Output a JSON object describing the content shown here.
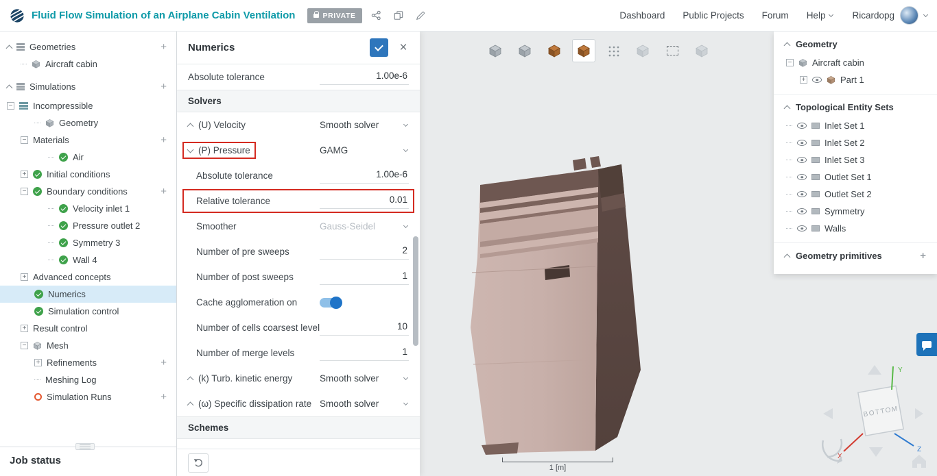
{
  "colors": {
    "accent_blue": "#2e76bc",
    "title_teal": "#0e9aa8",
    "selected_row": "#d7ebf8",
    "annotation_red": "#d42a20",
    "toggle_blue": "#1f74c8",
    "check_green": "#3fa24b",
    "runs_red": "#e4572e"
  },
  "header": {
    "project_title": "Fluid Flow Simulation of an Airplane Cabin Ventilation",
    "privacy_badge": "PRIVATE",
    "nav_items": [
      {
        "label": "Dashboard"
      },
      {
        "label": "Public Projects"
      },
      {
        "label": "Forum"
      },
      {
        "label": "Help",
        "has_caret": true
      }
    ],
    "username": "Ricardopg"
  },
  "left_tree": {
    "items": [
      {
        "label": "Geometries",
        "level": 0,
        "expander": "caret",
        "icon": "layers-icon",
        "plus": true
      },
      {
        "label": "Aircraft cabin",
        "level": 1,
        "icon": "geometry-icon",
        "dash": true
      },
      {
        "label": "Simulations",
        "level": 0,
        "expander": "caret",
        "icon": "simulations-icon",
        "plus": true
      },
      {
        "label": "Incompressible",
        "level": 0,
        "expander": "minus",
        "icon": "flow-icon"
      },
      {
        "label": "Geometry",
        "level": 2,
        "icon": "geometry-icon",
        "dash": true
      },
      {
        "label": "Materials",
        "level": 1,
        "expander": "minus",
        "plus": true
      },
      {
        "label": "Air",
        "level": 3,
        "icon": "check-icon",
        "dash": true
      },
      {
        "label": "Initial conditions",
        "level": 1,
        "expander": "plus",
        "icon": "check-icon"
      },
      {
        "label": "Boundary conditions",
        "level": 1,
        "expander": "minus",
        "icon": "check-icon",
        "plus": true
      },
      {
        "label": "Velocity inlet 1",
        "level": 3,
        "icon": "check-icon",
        "dash": true
      },
      {
        "label": "Pressure outlet 2",
        "level": 3,
        "icon": "check-icon",
        "dash": true
      },
      {
        "label": "Symmetry 3",
        "level": 3,
        "icon": "check-icon",
        "dash": true
      },
      {
        "label": "Wall 4",
        "level": 3,
        "icon": "check-icon",
        "dash": true
      },
      {
        "label": "Advanced concepts",
        "level": 1,
        "expander": "plus"
      },
      {
        "label": "Numerics",
        "level": 2,
        "icon": "check-icon",
        "selected": true
      },
      {
        "label": "Simulation control",
        "level": 2,
        "icon": "check-icon"
      },
      {
        "label": "Result control",
        "level": 1,
        "expander": "plus"
      },
      {
        "label": "Mesh",
        "level": 1,
        "expander": "minus",
        "icon": "mesh-icon"
      },
      {
        "label": "Refinements",
        "level": 2,
        "expander": "plus",
        "plus": true
      },
      {
        "label": "Meshing Log",
        "level": 2,
        "dash": true
      },
      {
        "label": "Simulation Runs",
        "level": 2,
        "icon": "runs-icon",
        "plus": true
      }
    ]
  },
  "job_status": {
    "label": "Job status"
  },
  "numerics_panel": {
    "title": "Numerics",
    "rows": [
      {
        "type": "input",
        "label": "Absolute tolerance",
        "value": "1.00e-6"
      },
      {
        "type": "section",
        "label": "Solvers"
      },
      {
        "type": "select",
        "label": "(U) Velocity",
        "value": "Smooth solver",
        "collapser": "up"
      },
      {
        "type": "select",
        "label": "(P) Pressure",
        "value": "GAMG",
        "collapser": "down",
        "highlight": "label"
      },
      {
        "type": "input",
        "label": "Absolute tolerance",
        "value": "1.00e-6",
        "indent": true
      },
      {
        "type": "input",
        "label": "Relative tolerance",
        "value": "0.01",
        "indent": true,
        "highlight": "row"
      },
      {
        "type": "select",
        "label": "Smoother",
        "value": "Gauss-Seidel",
        "indent": true,
        "disabled": true
      },
      {
        "type": "input",
        "label": "Number of pre sweeps",
        "value": "2",
        "indent": true
      },
      {
        "type": "input",
        "label": "Number of post sweeps",
        "value": "1",
        "indent": true
      },
      {
        "type": "toggle",
        "label": "Cache agglomeration on",
        "on": true,
        "indent": true
      },
      {
        "type": "input",
        "label": "Number of cells coarsest level",
        "value": "10",
        "indent": true
      },
      {
        "type": "input",
        "label": "Number of merge levels",
        "value": "1",
        "indent": true
      },
      {
        "type": "select",
        "label": "(k) Turb. kinetic energy",
        "value": "Smooth solver",
        "collapser": "up"
      },
      {
        "type": "select",
        "label": "(ω) Specific dissipation rate",
        "value": "Smooth solver",
        "collapser": "up"
      },
      {
        "type": "section",
        "label": "Schemes"
      }
    ]
  },
  "viewport": {
    "toolbar": [
      {
        "name": "view-geometry-icon"
      },
      {
        "name": "view-solid-icon"
      },
      {
        "name": "view-surfaces-icon",
        "accent": true
      },
      {
        "name": "view-volumes-icon",
        "accent": true,
        "selected": true
      },
      {
        "name": "view-grid-icon"
      },
      {
        "name": "view-transparent-icon",
        "disabled": true
      },
      {
        "name": "box-select-icon"
      },
      {
        "name": "view-mesh-icon",
        "disabled": true
      }
    ],
    "scale_label": "1 [m]",
    "nav_cube_label": "BOTTOM",
    "axes": {
      "x": "X",
      "y": "Y",
      "z": "Z"
    }
  },
  "right_panel": {
    "sections": [
      {
        "title": "Geometry",
        "items": [
          {
            "label": "Aircraft cabin",
            "expander": "minus",
            "icon": "part-gray-icon",
            "level": 0
          },
          {
            "label": "Part 1",
            "expander": "plus",
            "eye": true,
            "icon": "part-tan-icon",
            "level": 1
          }
        ]
      },
      {
        "title": "Topological Entity Sets",
        "items": [
          {
            "label": "Inlet Set 1",
            "dash": true,
            "eye": true,
            "icon": "face-set-icon"
          },
          {
            "label": "Inlet Set 2",
            "dash": true,
            "eye": true,
            "icon": "face-set-icon"
          },
          {
            "label": "Inlet Set 3",
            "dash": true,
            "eye": true,
            "icon": "face-set-icon"
          },
          {
            "label": "Outlet Set 1",
            "dash": true,
            "eye": true,
            "icon": "face-set-icon"
          },
          {
            "label": "Outlet Set 2",
            "dash": true,
            "eye": true,
            "icon": "face-set-icon"
          },
          {
            "label": "Symmetry",
            "dash": true,
            "eye": true,
            "icon": "face-set-icon"
          },
          {
            "label": "Walls",
            "dash": true,
            "eye": true,
            "icon": "face-set-icon"
          }
        ]
      },
      {
        "title": "Geometry primitives",
        "plus": true,
        "items": []
      }
    ]
  }
}
